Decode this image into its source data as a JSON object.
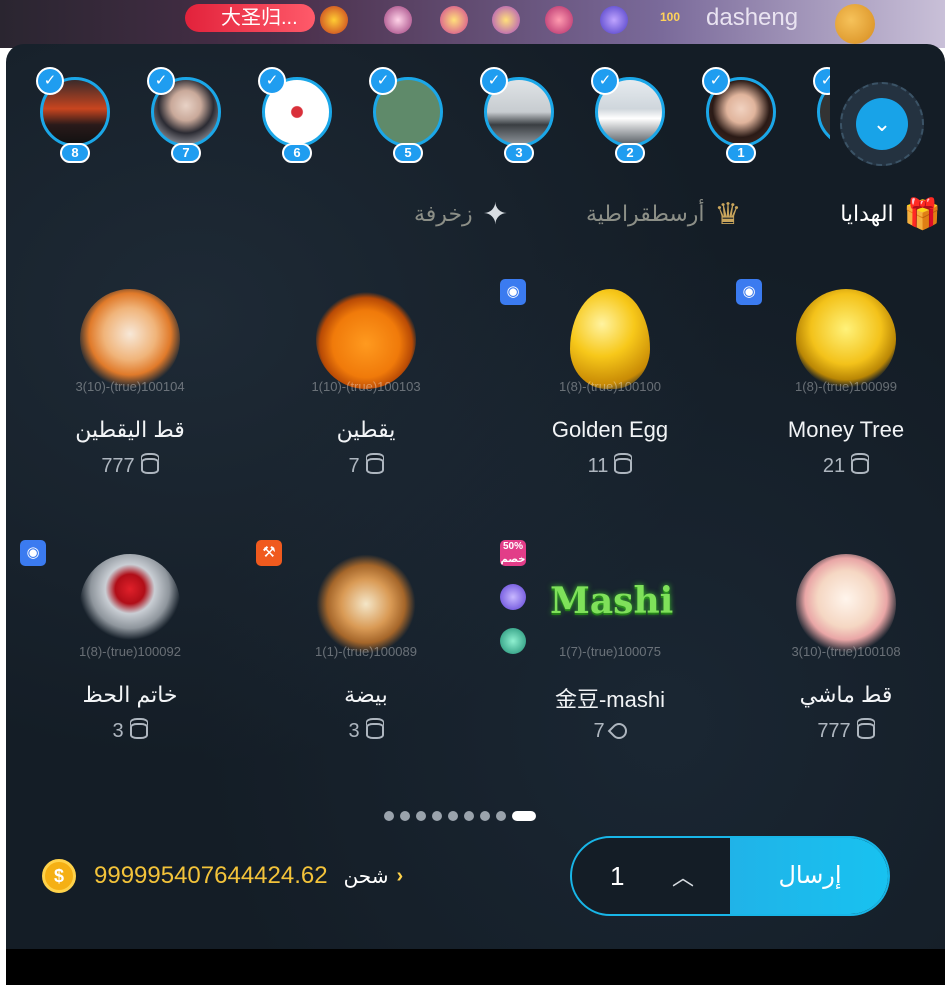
{
  "top_bar": {
    "pill_text": "大圣归...",
    "level_text": "100",
    "username": "dasheng"
  },
  "avatars": [
    {
      "rank": "8"
    },
    {
      "rank": "7"
    },
    {
      "rank": "6"
    },
    {
      "rank": "5"
    },
    {
      "rank": "3"
    },
    {
      "rank": "2"
    },
    {
      "rank": "1"
    }
  ],
  "tabs": {
    "gifts": "الهدايا",
    "aristocracy": "أرسطقراطية",
    "decoration": "زخرفة"
  },
  "gifts": [
    {
      "name": "قط اليقطين",
      "price": "777",
      "id_label": "3(10)-(true)100104",
      "currency": "coin"
    },
    {
      "name": "يقطين",
      "price": "7",
      "id_label": "1(10)-(true)100103",
      "currency": "coin"
    },
    {
      "name": "Golden Egg",
      "price": "11",
      "id_label": "1(8)-(true)100100",
      "currency": "coin"
    },
    {
      "name": "Money Tree",
      "price": "21",
      "id_label": "1(8)-(true)100099",
      "currency": "coin"
    },
    {
      "name": "خاتم الحظ",
      "price": "3",
      "id_label": "1(8)-(true)100092",
      "currency": "coin"
    },
    {
      "name": "بيضة",
      "price": "3",
      "id_label": "1(1)-(true)100089",
      "currency": "coin"
    },
    {
      "name": "金豆-mashi",
      "price": "7",
      "id_label": "1(7)-(true)100075",
      "currency": "bean",
      "art_text": "Mashi"
    },
    {
      "name": "قط ماشي",
      "price": "777",
      "id_label": "3(10)-(true)100108",
      "currency": "coin"
    }
  ],
  "discount_badge": {
    "line1": "50%",
    "line2": "خصم"
  },
  "pager": {
    "total": 9,
    "active": 9
  },
  "balance": {
    "amount": "999995407644424.62",
    "recharge_label": "شحن"
  },
  "send": {
    "quantity": "1",
    "button_label": "إرسال"
  },
  "colors": {
    "accent": "#18b6e8",
    "panel_bg": "#141d26",
    "coin_gold": "#f3c33a"
  }
}
